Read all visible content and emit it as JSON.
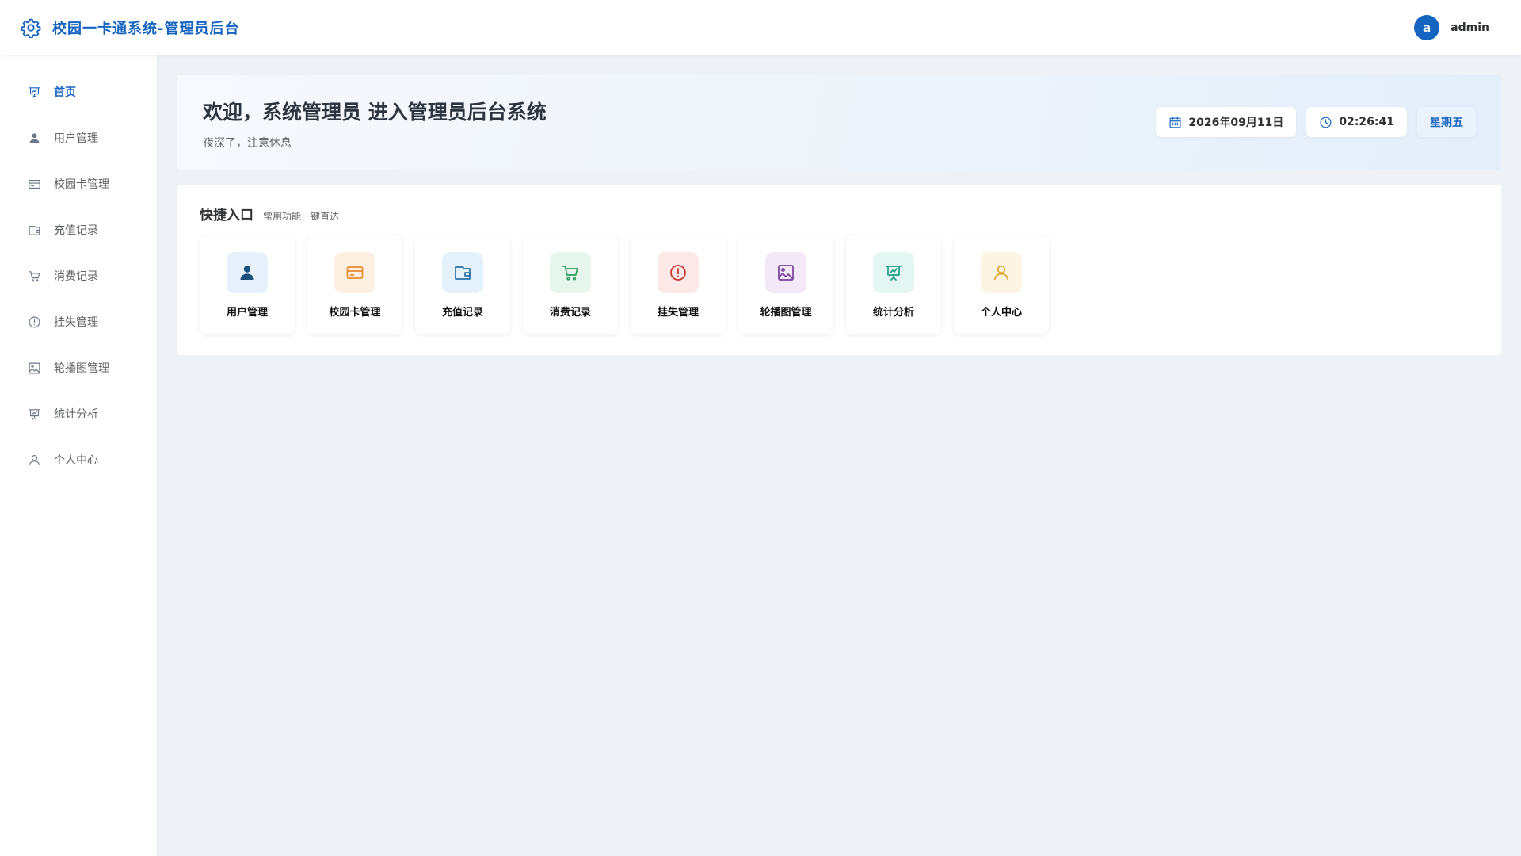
{
  "header": {
    "title": "校园一卡通系统-管理员后台",
    "brand_icon": "gear-icon",
    "user": {
      "avatar_letter": "a",
      "name": "admin"
    }
  },
  "sidebar": {
    "items": [
      {
        "label": "首页",
        "icon": "presentation-chart-icon",
        "active": true
      },
      {
        "label": "用户管理",
        "icon": "user-icon",
        "active": false
      },
      {
        "label": "校园卡管理",
        "icon": "credit-card-icon",
        "active": false
      },
      {
        "label": "充值记录",
        "icon": "wallet-icon",
        "active": false
      },
      {
        "label": "消费记录",
        "icon": "cart-icon",
        "active": false
      },
      {
        "label": "挂失管理",
        "icon": "warning-circle-icon",
        "active": false
      },
      {
        "label": "轮播图管理",
        "icon": "picture-icon",
        "active": false
      },
      {
        "label": "统计分析",
        "icon": "presentation-chart-icon",
        "active": false
      },
      {
        "label": "个人中心",
        "icon": "person-outline-icon",
        "active": false
      }
    ]
  },
  "welcome": {
    "title": "欢迎，系统管理员 进入管理员后台系统",
    "subtitle": "夜深了，注意休息",
    "date": "2026年09月11日",
    "time": "02:26:41",
    "weekday": "星期五"
  },
  "quick": {
    "title": "快捷入口",
    "subtitle": "常用功能一键直达",
    "items": [
      {
        "label": "用户管理",
        "icon": "user-icon",
        "color": "#1a4f7a",
        "bg": "#e6f1fb"
      },
      {
        "label": "校园卡管理",
        "icon": "credit-card-icon",
        "color": "#e8892a",
        "bg": "#fdf0e3"
      },
      {
        "label": "充值记录",
        "icon": "wallet-icon",
        "color": "#2a6fa8",
        "bg": "#e5f2fb"
      },
      {
        "label": "消费记录",
        "icon": "cart-icon",
        "color": "#2e9b5c",
        "bg": "#e6f6ec"
      },
      {
        "label": "挂失管理",
        "icon": "warning-circle-icon",
        "color": "#c9302c",
        "bg": "#fce8e7"
      },
      {
        "label": "轮播图管理",
        "icon": "picture-icon",
        "color": "#7a3f9b",
        "bg": "#f3e8f8"
      },
      {
        "label": "统计分析",
        "icon": "presentation-chart-icon",
        "color": "#1e9c8a",
        "bg": "#e3f6f2"
      },
      {
        "label": "个人中心",
        "icon": "person-outline-icon",
        "color": "#e0a02a",
        "bg": "#fdf5e3"
      }
    ]
  },
  "colors": {
    "primary": "#1565c0",
    "background": "#eef2f7",
    "sidebar_icon": "#6b7588"
  }
}
